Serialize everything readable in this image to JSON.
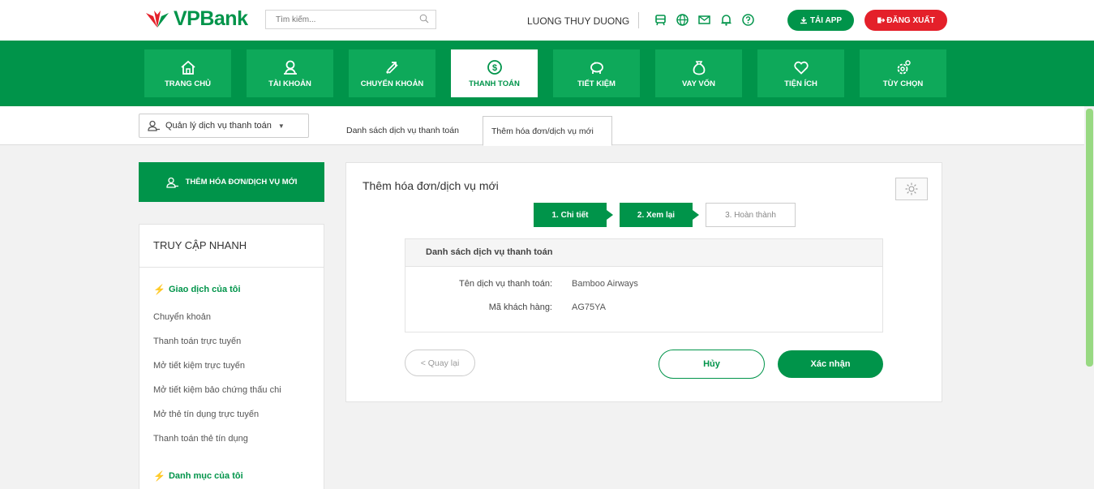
{
  "header": {
    "brand": "VPBank",
    "search_placeholder": "Tìm kiếm...",
    "username": "LUONG THUY DUONG",
    "icons": [
      "bank-icon",
      "globe-icon",
      "mail-icon",
      "bell-icon",
      "help-icon"
    ],
    "app_button": "TẢI APP",
    "logout_button": "ĐĂNG XUẤT"
  },
  "nav": {
    "items": [
      {
        "label": "TRANG CHỦ",
        "icon": "home-icon"
      },
      {
        "label": "TÀI KHOẢN",
        "icon": "user-icon"
      },
      {
        "label": "CHUYỂN KHOẢN",
        "icon": "transfer-icon"
      },
      {
        "label": "THANH TOÁN",
        "icon": "dollar-icon",
        "active": true
      },
      {
        "label": "TIẾT KIỆM",
        "icon": "piggy-bank-icon"
      },
      {
        "label": "VAY VỐN",
        "icon": "money-bag-icon"
      },
      {
        "label": "TIỆN ÍCH",
        "icon": "heart-icon"
      },
      {
        "label": "TÙY CHỌN",
        "icon": "settings-icon"
      }
    ]
  },
  "subbar": {
    "service_dropdown": "Quản lý dịch vụ thanh toán",
    "tabs": [
      {
        "label": "Danh sách dịch vụ thanh toán"
      },
      {
        "label": "Thêm hóa đơn/dịch vụ mới",
        "active": true
      }
    ]
  },
  "sidebar": {
    "add_button": "THÊM HÓA ĐƠN/DỊCH VỤ MỚI",
    "quick_title": "TRUY CẬP NHANH",
    "section1": "Giao dịch của tôi",
    "links": [
      "Chuyển khoản",
      "Thanh toán trực tuyến",
      "Mở tiết kiệm trực tuyến",
      "Mở tiết kiệm bảo chứng thấu chi",
      "Mở thẻ tín dụng trực tuyến",
      "Thanh toán thẻ tín dụng"
    ],
    "section2": "Danh mục của tôi"
  },
  "main": {
    "title": "Thêm hóa đơn/dịch vụ mới",
    "steps": [
      {
        "label": "1. Chi tiết",
        "state": "done"
      },
      {
        "label": "2. Xem lại",
        "state": "done"
      },
      {
        "label": "3. Hoàn thành",
        "state": "pending"
      }
    ],
    "box_title": "Danh sách dịch vụ thanh toán",
    "fields": [
      {
        "label": "Tên dịch vụ thanh toán:",
        "value": "Bamboo Airways"
      },
      {
        "label": "Mã khách hàng:",
        "value": "AG75YA"
      }
    ],
    "back_button": "< Quay lại",
    "cancel_button": "Hủy",
    "confirm_button": "Xác nhận"
  },
  "colors": {
    "brand_green": "#00944a",
    "nav_tile": "#0ea95a",
    "logout_red": "#e4202a"
  }
}
